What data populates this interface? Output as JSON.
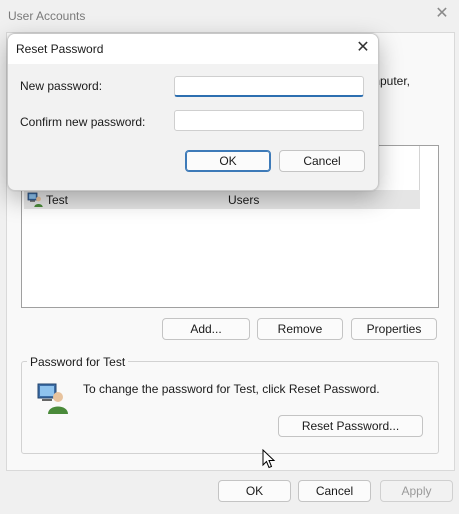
{
  "window": {
    "title": "User Accounts",
    "description_fragment": "mputer,"
  },
  "users_list": {
    "rows": [
      {
        "name": "Test",
        "group": "Users"
      }
    ]
  },
  "list_buttons": {
    "add": "Add...",
    "remove": "Remove",
    "properties": "Properties"
  },
  "password_group": {
    "legend": "Password for Test",
    "text": "To change the password for Test, click Reset Password.",
    "reset_button": "Reset Password..."
  },
  "footer": {
    "ok": "OK",
    "cancel": "Cancel",
    "apply": "Apply"
  },
  "dialog": {
    "title": "Reset Password",
    "new_password_label": "New password:",
    "confirm_password_label": "Confirm new password:",
    "new_password_value": "",
    "confirm_password_value": "",
    "ok": "OK",
    "cancel": "Cancel"
  },
  "colors": {
    "focus_accent": "#2d6fb0",
    "selected_row": "#e5e5e5"
  }
}
